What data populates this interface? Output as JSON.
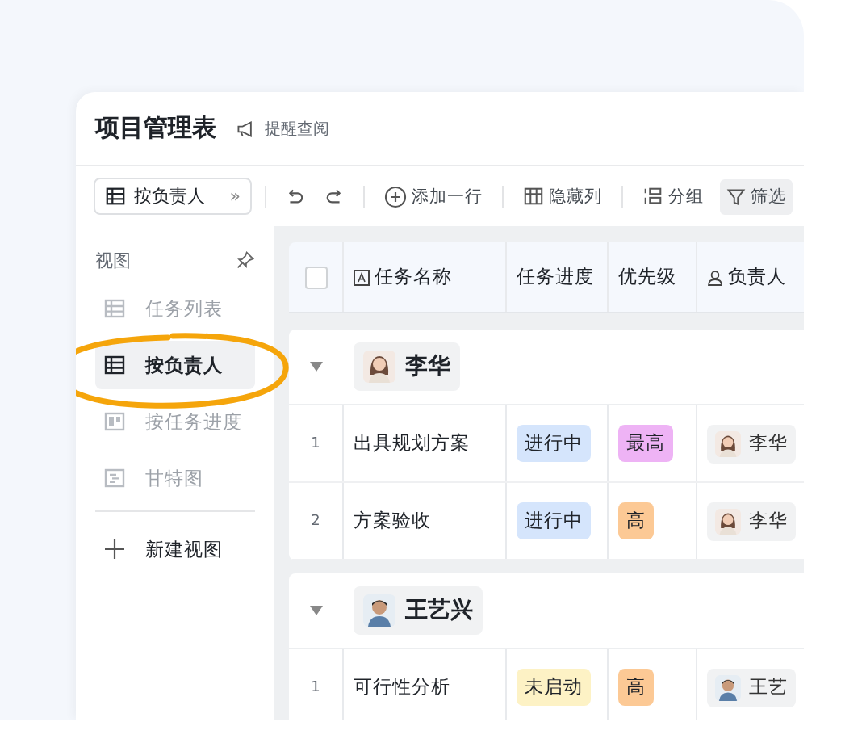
{
  "title": "项目管理表",
  "remind": "提醒查阅",
  "toolbar": {
    "view": "按负责人",
    "view_more": "»",
    "actions": [
      {
        "kind": "undo"
      },
      {
        "kind": "redo"
      },
      {
        "kind": "add",
        "label": "添加一行"
      },
      {
        "kind": "hide",
        "label": "隐藏列"
      },
      {
        "kind": "group",
        "label": "分组"
      },
      {
        "kind": "filter",
        "label": "筛选"
      }
    ]
  },
  "sidebar": {
    "heading": "视图",
    "items": [
      {
        "kind": "list",
        "label": "任务列表",
        "selected": false
      },
      {
        "kind": "table",
        "label": "按负责人",
        "selected": true
      },
      {
        "kind": "kanban",
        "label": "按任务进度",
        "selected": false
      },
      {
        "kind": "gantt",
        "label": "甘特图",
        "selected": false
      }
    ],
    "new_view": "新建视图"
  },
  "table": {
    "select_all": {
      "checked": false
    },
    "columns": [
      {
        "kind": "text",
        "label": "任务名称"
      },
      {
        "kind": "plain",
        "label": "任务进度"
      },
      {
        "kind": "plain",
        "label": "优先级"
      },
      {
        "kind": "person",
        "label": "负责人"
      }
    ],
    "groups": [
      {
        "owner": "李华",
        "expanded": true,
        "rows": [
          {
            "index": "1",
            "name": "出具规划方案",
            "progress": {
              "label": "进行中",
              "color": "#d5e5fc"
            },
            "priority": {
              "label": "最高",
              "color": "#eeb3f5"
            },
            "owner": "李华"
          },
          {
            "index": "2",
            "name": "方案验收",
            "progress": {
              "label": "进行中",
              "color": "#d5e5fc"
            },
            "priority": {
              "label": "高",
              "color": "#fcc995"
            },
            "owner": "李华"
          }
        ]
      },
      {
        "owner": "王艺兴",
        "expanded": true,
        "rows": [
          {
            "index": "1",
            "name": "可行性分析",
            "progress": {
              "label": "未启动",
              "color": "#fdf2c5"
            },
            "priority": {
              "label": "高",
              "color": "#fcc995"
            },
            "owner": "王艺"
          }
        ]
      }
    ]
  }
}
